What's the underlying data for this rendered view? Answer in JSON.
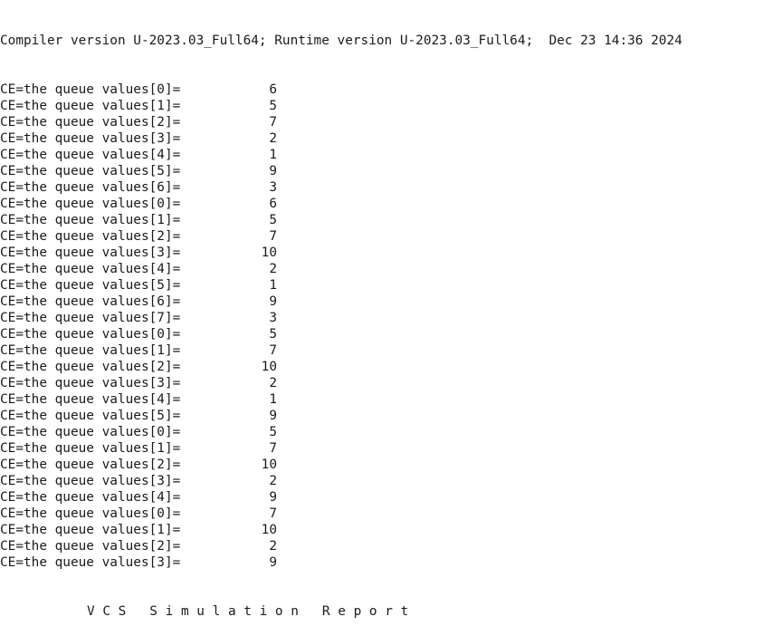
{
  "header": "Compiler version U-2023.03_Full64; Runtime version U-2023.03_Full64;  Dec 23 14:36 2024",
  "lines": [
    {
      "label": "CE=the queue values[0]=",
      "value": "6"
    },
    {
      "label": "CE=the queue values[1]=",
      "value": "5"
    },
    {
      "label": "CE=the queue values[2]=",
      "value": "7"
    },
    {
      "label": "CE=the queue values[3]=",
      "value": "2"
    },
    {
      "label": "CE=the queue values[4]=",
      "value": "1"
    },
    {
      "label": "CE=the queue values[5]=",
      "value": "9"
    },
    {
      "label": "CE=the queue values[6]=",
      "value": "3"
    },
    {
      "label": "CE=the queue values[0]=",
      "value": "6"
    },
    {
      "label": "CE=the queue values[1]=",
      "value": "5"
    },
    {
      "label": "CE=the queue values[2]=",
      "value": "7"
    },
    {
      "label": "CE=the queue values[3]=",
      "value": "10"
    },
    {
      "label": "CE=the queue values[4]=",
      "value": "2"
    },
    {
      "label": "CE=the queue values[5]=",
      "value": "1"
    },
    {
      "label": "CE=the queue values[6]=",
      "value": "9"
    },
    {
      "label": "CE=the queue values[7]=",
      "value": "3"
    },
    {
      "label": "CE=the queue values[0]=",
      "value": "5"
    },
    {
      "label": "CE=the queue values[1]=",
      "value": "7"
    },
    {
      "label": "CE=the queue values[2]=",
      "value": "10"
    },
    {
      "label": "CE=the queue values[3]=",
      "value": "2"
    },
    {
      "label": "CE=the queue values[4]=",
      "value": "1"
    },
    {
      "label": "CE=the queue values[5]=",
      "value": "9"
    },
    {
      "label": "CE=the queue values[0]=",
      "value": "5"
    },
    {
      "label": "CE=the queue values[1]=",
      "value": "7"
    },
    {
      "label": "CE=the queue values[2]=",
      "value": "10"
    },
    {
      "label": "CE=the queue values[3]=",
      "value": "2"
    },
    {
      "label": "CE=the queue values[4]=",
      "value": "9"
    },
    {
      "label": "CE=the queue values[0]=",
      "value": "7"
    },
    {
      "label": "CE=the queue values[1]=",
      "value": "10"
    },
    {
      "label": "CE=the queue values[2]=",
      "value": "2"
    },
    {
      "label": "CE=the queue values[3]=",
      "value": "9"
    }
  ],
  "footer": "V C S   S i m u l a t i o n   R e p o r t"
}
